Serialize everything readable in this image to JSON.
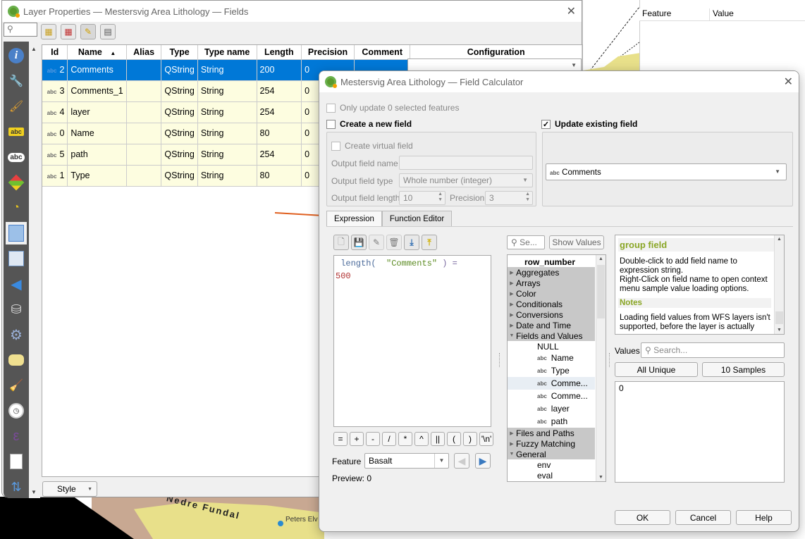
{
  "layer_properties": {
    "title": "Layer Properties — Mestersvig Area Lithology — Fields",
    "search_placeholder": "",
    "toolbar": [
      {
        "icon": "new-field-icon"
      },
      {
        "icon": "delete-field-icon"
      },
      {
        "icon": "toggle-edit-icon"
      },
      {
        "icon": "field-calculator-icon"
      }
    ],
    "sidebar": [
      {
        "icon": "information-icon"
      },
      {
        "icon": "source-icon"
      },
      {
        "icon": "symbology-icon"
      },
      {
        "icon": "labels-icon"
      },
      {
        "icon": "masks-icon"
      },
      {
        "icon": "3d-view-icon"
      },
      {
        "icon": "diagrams-icon"
      },
      {
        "icon": "fields-icon",
        "active": true
      },
      {
        "icon": "attributes-form-icon"
      },
      {
        "icon": "joins-icon"
      },
      {
        "icon": "auxiliary-storage-icon"
      },
      {
        "icon": "actions-icon"
      },
      {
        "icon": "display-icon"
      },
      {
        "icon": "rendering-icon"
      },
      {
        "icon": "temporal-icon"
      },
      {
        "icon": "variables-icon"
      },
      {
        "icon": "metadata-icon"
      },
      {
        "icon": "dependencies-icon"
      }
    ],
    "table": {
      "columns": [
        "Id",
        "Name",
        "Alias",
        "Type",
        "Type name",
        "Length",
        "Precision",
        "Comment",
        "Configuration"
      ],
      "rows": [
        {
          "badge": "abc",
          "id": "2",
          "name": "Comments",
          "alias": "",
          "type": "QString",
          "type_name": "String",
          "length": "200",
          "precision": "0",
          "comment": "",
          "selected": true
        },
        {
          "badge": "abc",
          "id": "3",
          "name": "Comments_1",
          "alias": "",
          "type": "QString",
          "type_name": "String",
          "length": "254",
          "precision": "0",
          "comment": ""
        },
        {
          "badge": "abc",
          "id": "4",
          "name": "layer",
          "alias": "",
          "type": "QString",
          "type_name": "String",
          "length": "254",
          "precision": "0",
          "comment": ""
        },
        {
          "badge": "abc",
          "id": "0",
          "name": "Name",
          "alias": "",
          "type": "QString",
          "type_name": "String",
          "length": "80",
          "precision": "0",
          "comment": ""
        },
        {
          "badge": "abc",
          "id": "5",
          "name": "path",
          "alias": "",
          "type": "QString",
          "type_name": "String",
          "length": "254",
          "precision": "0",
          "comment": ""
        },
        {
          "badge": "abc",
          "id": "1",
          "name": "Type",
          "alias": "",
          "type": "QString",
          "type_name": "String",
          "length": "80",
          "precision": "0",
          "comment": ""
        }
      ]
    },
    "style_button": "Style"
  },
  "identify_panel": {
    "columns": [
      "Feature",
      "Value"
    ]
  },
  "map_labels": {
    "valley": "Nedre Fundal",
    "place": "Peters Elv"
  },
  "field_calculator": {
    "title": "Mestersvig Area Lithology — Field Calculator",
    "only_selected": "Only update 0 selected features",
    "create_new_field": "Create a new field",
    "create_virtual": "Create virtual field",
    "output_field_name_label": "Output field name",
    "output_field_name": "",
    "output_field_type_label": "Output field type",
    "output_field_type": "Whole number (integer)",
    "output_field_length_label": "Output field length",
    "output_field_length": "10",
    "precision_label": "Precision",
    "precision": "3",
    "update_existing": "Update existing field",
    "update_existing_checked": true,
    "existing_field_badge": "abc",
    "existing_field": "Comments",
    "tabs": [
      "Expression",
      "Function Editor"
    ],
    "active_tab": "Expression",
    "expression_line1_fn": "length(",
    "expression_line1_field": "\"Comments\"",
    "expression_line1_rest": ") =",
    "expression_line2": "500",
    "operators": [
      "=",
      "+",
      "-",
      "/",
      "*",
      "^",
      "||",
      "(",
      ")",
      "'\\n'"
    ],
    "feature_label": "Feature",
    "feature_value": "Basalt",
    "preview_label": "Preview:",
    "preview_value": "0",
    "search_placeholder": "Se...",
    "show_values": "Show Values",
    "function_tree": [
      {
        "label": "row_number",
        "level": 0,
        "bold": true
      },
      {
        "label": "Aggregates",
        "group": true,
        "expanded": false
      },
      {
        "label": "Arrays",
        "group": true,
        "expanded": false
      },
      {
        "label": "Color",
        "group": true,
        "expanded": false
      },
      {
        "label": "Conditionals",
        "group": true,
        "expanded": false
      },
      {
        "label": "Conversions",
        "group": true,
        "expanded": false
      },
      {
        "label": "Date and Time",
        "group": true,
        "expanded": false
      },
      {
        "label": "Fields and Values",
        "group": true,
        "expanded": true
      },
      {
        "label": "NULL",
        "level": 1
      },
      {
        "label": "Name",
        "level": 1,
        "badge": "abc"
      },
      {
        "label": "Type",
        "level": 1,
        "badge": "abc"
      },
      {
        "label": "Comme...",
        "level": 1,
        "badge": "abc",
        "hover": true
      },
      {
        "label": "Comme...",
        "level": 1,
        "badge": "abc"
      },
      {
        "label": "layer",
        "level": 1,
        "badge": "abc"
      },
      {
        "label": "path",
        "level": 1,
        "badge": "abc"
      },
      {
        "label": "Files and Paths",
        "group": true,
        "expanded": false
      },
      {
        "label": "Fuzzy Matching",
        "group": true,
        "expanded": false
      },
      {
        "label": "General",
        "group": true,
        "expanded": true
      },
      {
        "label": "env",
        "level": 1
      },
      {
        "label": "eval",
        "level": 1
      }
    ],
    "help": {
      "title": "group field",
      "body1": "Double-click to add field name to expression string.",
      "body2": "Right-Click on field name to open context menu sample value loading options.",
      "notes_title": "Notes",
      "notes_body": "Loading field values from WFS layers isn't supported, before the layer is actually"
    },
    "values_label": "Values",
    "values_search_placeholder": "Search...",
    "all_unique": "All Unique",
    "ten_samples": "10 Samples",
    "values_list": [
      "0"
    ],
    "ok": "OK",
    "cancel": "Cancel",
    "help_button": "Help"
  },
  "colors": {
    "selection": "#0078d7",
    "table_row_bg": "#fdfde0",
    "help_title": "#8aa626",
    "annotation_line": "#e06020"
  }
}
